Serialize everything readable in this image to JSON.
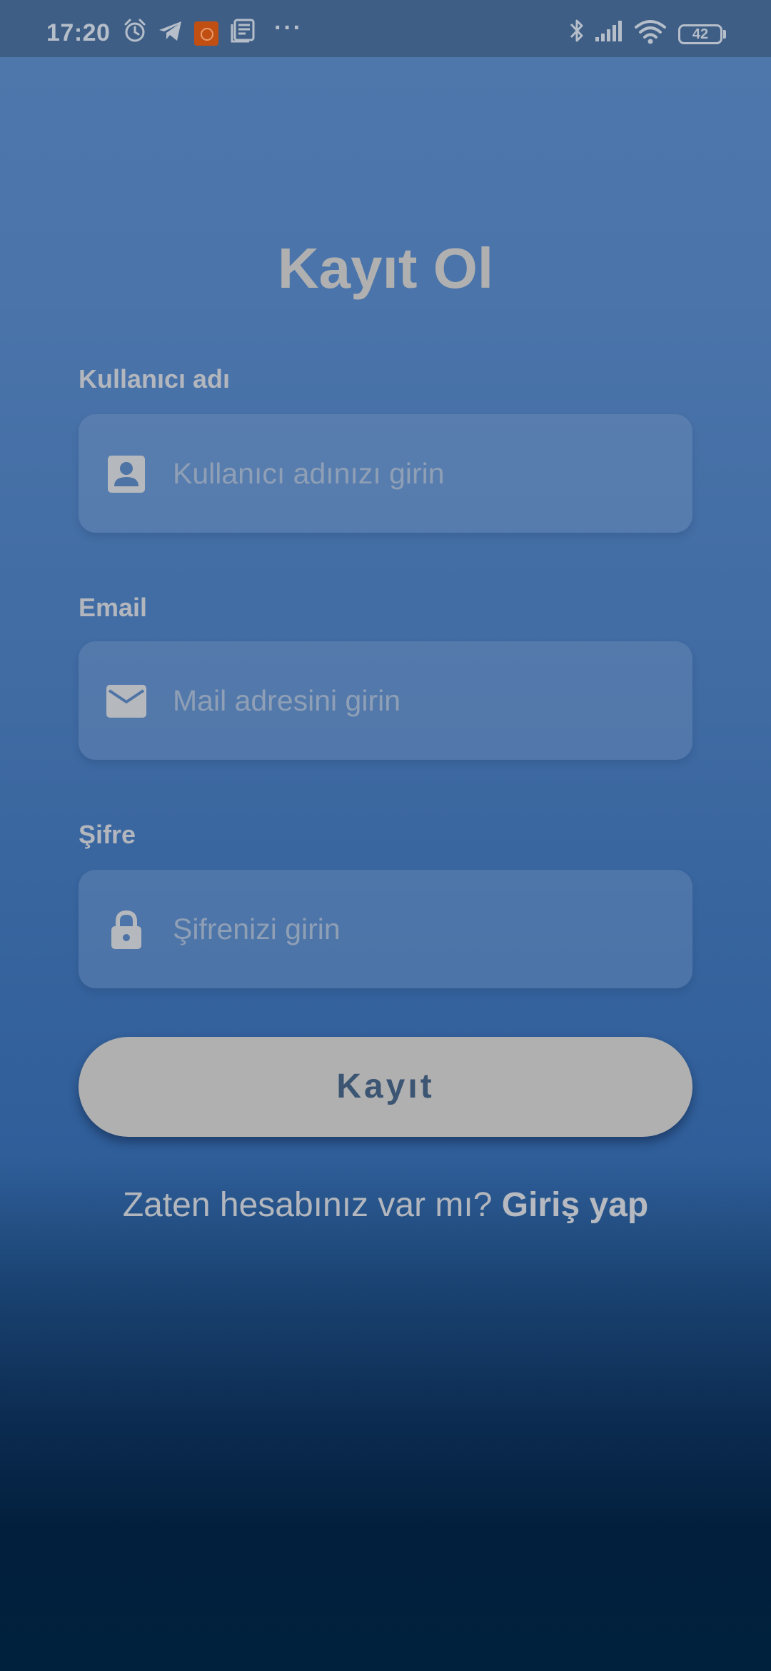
{
  "status_bar": {
    "time": "17:20",
    "battery": "42",
    "icons": [
      "alarm-icon",
      "telegram-icon",
      "mi-app-icon",
      "news-icon",
      "more-dots-icon",
      "bluetooth-icon",
      "signal-icon",
      "wifi-icon",
      "battery-icon"
    ],
    "more": "···"
  },
  "page": {
    "title": "Kayıt Ol"
  },
  "form": {
    "username": {
      "label": "Kullanıcı adı",
      "placeholder": "Kullanıcı adınızı girin",
      "value": "",
      "icon": "account-box-icon"
    },
    "email": {
      "label": "Email",
      "placeholder": "Mail adresini girin",
      "value": "",
      "icon": "mail-icon"
    },
    "password": {
      "label": "Şifre",
      "placeholder": "Şifrenizi girin",
      "value": "",
      "icon": "lock-icon"
    },
    "submit_label": "Kayıt"
  },
  "footer": {
    "prompt": "Zaten hesabınız var mı?",
    "link": "Giriş yap"
  },
  "colors": {
    "status_bar": "#3e5e86",
    "gradient_top": "#4f78ad",
    "gradient_bottom": "#00213d",
    "button": "#b0b0b0",
    "button_text": "#3b5573"
  }
}
